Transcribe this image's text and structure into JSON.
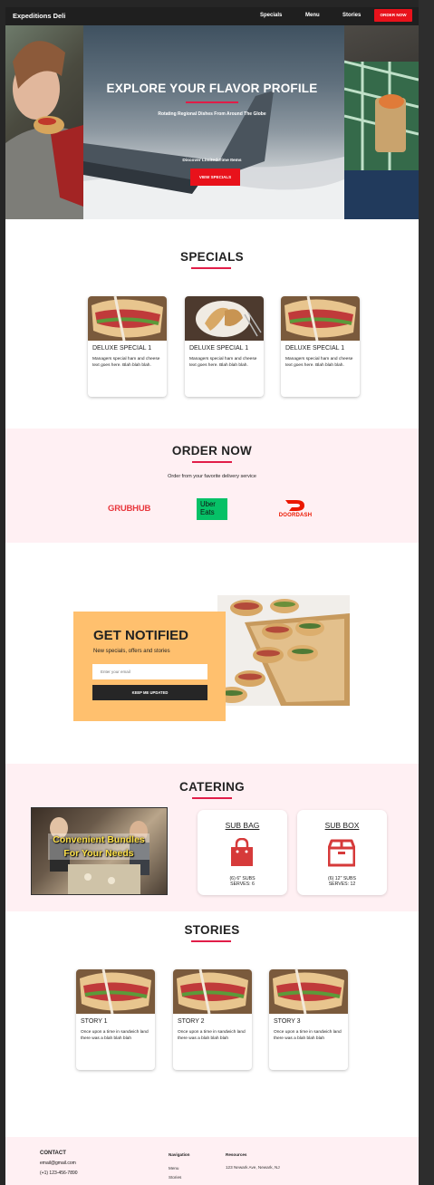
{
  "nav": {
    "brand": "Expeditions Deli",
    "links": [
      "Specials",
      "Menu",
      "Stories"
    ],
    "order_button": "ORDER NOW"
  },
  "hero": {
    "title": "EXPLORE YOUR FLAVOR PROFILE",
    "subtitle": "Rotating Regional Dishes From Around The Globe",
    "discover": "Discover Limited-Time Items",
    "button": "VIEW SPECIALS"
  },
  "specials": {
    "title": "SPECIALS",
    "cards": [
      {
        "title": "DELUXE SPECIAL 1",
        "text": "Managers special ham and cheese text goes here. Blah blah blah."
      },
      {
        "title": "DELUXE SPECIAL 1",
        "text": "Managers special ham and cheese text goes here. Blah blah blah."
      },
      {
        "title": "DELUXE SPECIAL 1",
        "text": "Managers special ham and cheese text goes here. Blah blah blah."
      }
    ]
  },
  "order_now": {
    "title": "ORDER NOW",
    "text": "Order from your favorite delivery service",
    "services": [
      "GRUBHUB",
      "Uber Eats",
      "DOORDASH"
    ]
  },
  "notify": {
    "title": "GET NOTIFIED",
    "subtitle": "New specials, offers and stories",
    "placeholder": "Enter your email",
    "button": "KEEP ME UPDATED"
  },
  "catering": {
    "title": "CATERING",
    "photo_caption": "Convenient Bundles For Your Needs",
    "items": [
      {
        "title": "SUB BAG",
        "detail_1": "(6) 6\" SUBS",
        "detail_2": "SERVES: 6",
        "icon": "shopping-bag-icon"
      },
      {
        "title": "SUB BOX",
        "detail_1": "(6) 12\" SUBS",
        "detail_2": "SERVES: 12",
        "icon": "box-icon"
      }
    ]
  },
  "stories": {
    "title": "STORIES",
    "cards": [
      {
        "title": "STORY 1",
        "text": "Once upon a time in sandwich land there was a blah blah blah"
      },
      {
        "title": "STORY 2",
        "text": "Once upon a time in sandwich land there was a blah blah blah"
      },
      {
        "title": "STORY 3",
        "text": "Once upon a time in sandwich land there was a blah blah blah"
      }
    ]
  },
  "footer": {
    "contact_heading": "CONTACT",
    "email": "email@gmail.com",
    "phone": "(+1) 123-456-7890",
    "nav_heading": "Navigation",
    "nav_links": [
      "Menu",
      "Stories"
    ],
    "resources_heading": "Resources",
    "address": "123 Newark Ave, Newark, NJ"
  },
  "colors": {
    "accent_red": "#e8121b",
    "rule_pink": "#e11d48",
    "section_pink": "#fff0f3",
    "notify_orange": "#ffc06e",
    "nav_dark": "#1f1f1f"
  }
}
